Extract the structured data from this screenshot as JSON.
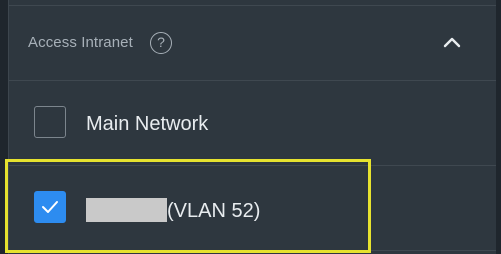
{
  "section": {
    "title": "Access Intranet",
    "help_glyph": "?",
    "expanded": true
  },
  "options": [
    {
      "label": "Main Network",
      "checked": false
    },
    {
      "label_prefix_redacted": true,
      "label": "(VLAN 52)",
      "checked": true
    }
  ],
  "colors": {
    "background": "#1f262d",
    "panel": "#2e373f",
    "accent": "#2d8cf0",
    "highlight": "#e6e22f"
  }
}
